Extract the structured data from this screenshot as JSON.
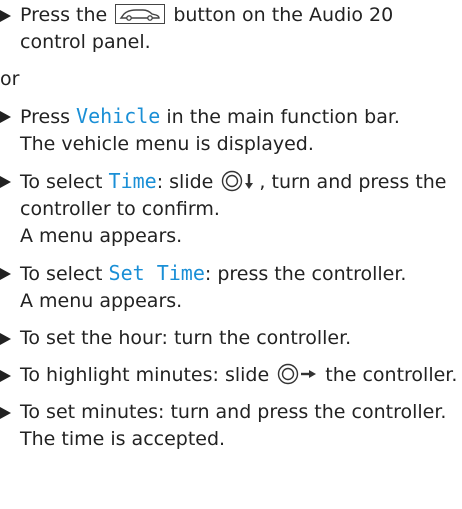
{
  "steps_top": [
    {
      "pre": "Press the",
      "icon": "car-button-icon",
      "post": "button on the Audio 20 control panel."
    }
  ],
  "or_text": "or",
  "steps": [
    {
      "pre": "Press ",
      "kw": "Vehicle",
      "post": " in the main function bar.",
      "result": "The vehicle menu is displayed."
    },
    {
      "pre": "To select ",
      "kw": "Time",
      "post": ": slide",
      "ctrl_icon": "controller-slide-down-icon",
      "post2": ", turn and press the controller to confirm.",
      "result": "A menu appears."
    },
    {
      "pre": "To select ",
      "kw": "Set Time",
      "post": ": press the controller.",
      "result": "A menu appears."
    },
    {
      "pre": "To set the hour: turn the controller."
    },
    {
      "pre": "To highlight minutes: slide",
      "ctrl_icon": "controller-slide-right-icon",
      "post2": " the controller."
    },
    {
      "pre": "To set minutes: turn and press the controller.",
      "result": "The time is accepted."
    }
  ],
  "colors": {
    "keyword": "#1a8fd6",
    "text": "#222222"
  }
}
